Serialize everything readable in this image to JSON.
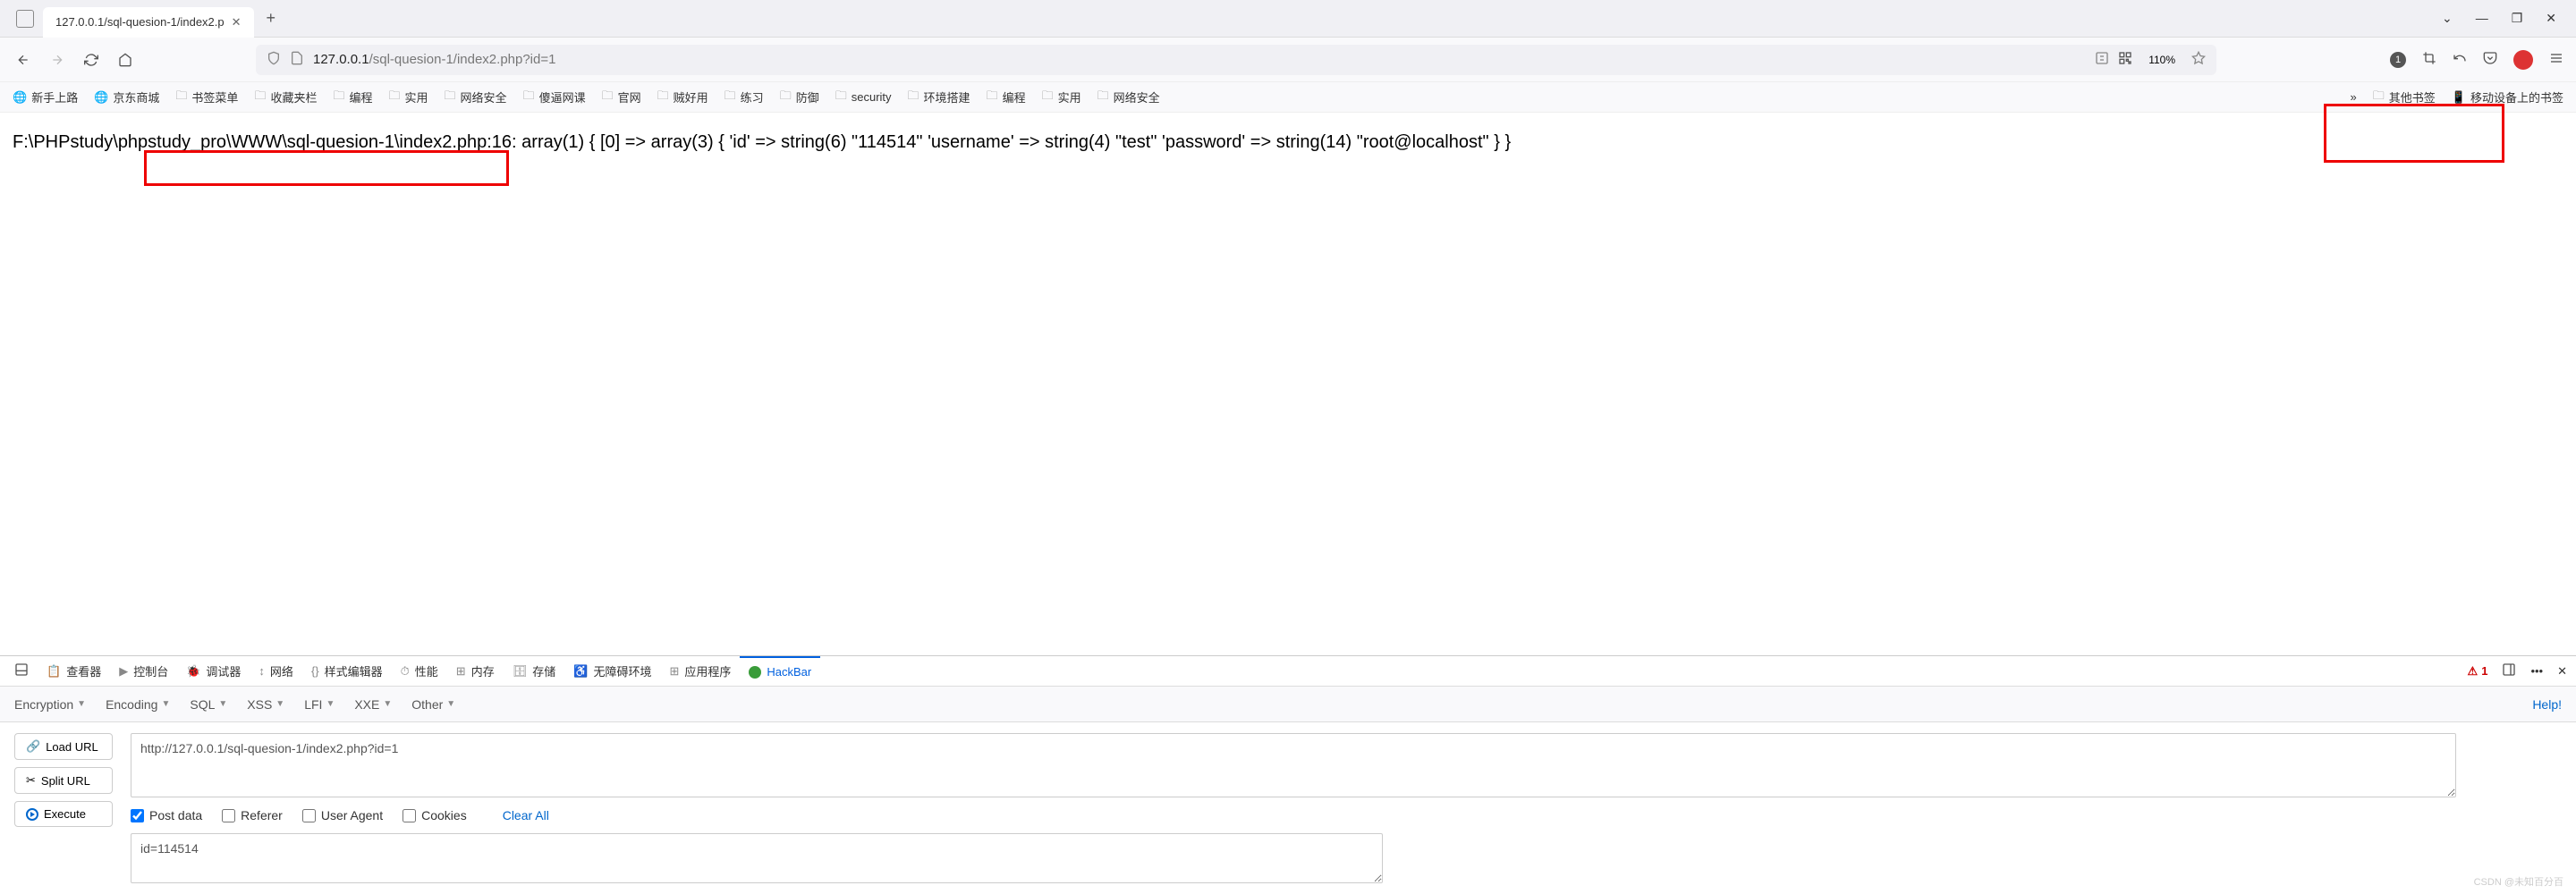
{
  "window": {
    "tab_title": "127.0.0.1/sql-quesion-1/index2.p",
    "new_tab": "+",
    "minimize": "—",
    "maximize": "❐",
    "close": "✕"
  },
  "nav": {
    "url_host": "127.0.0.1",
    "url_path": "/sql-quesion-1/index2.php?id=1",
    "zoom": "110%",
    "badge_count": "1"
  },
  "bookmarks": {
    "items": [
      {
        "icon": "globe",
        "label": "新手上路"
      },
      {
        "icon": "globe",
        "label": "京东商城"
      },
      {
        "icon": "folder",
        "label": "书签菜单"
      },
      {
        "icon": "folder",
        "label": "收藏夹栏"
      },
      {
        "icon": "folder",
        "label": "编程"
      },
      {
        "icon": "folder",
        "label": "实用"
      },
      {
        "icon": "folder",
        "label": "网络安全"
      },
      {
        "icon": "folder",
        "label": "傻逼网课"
      },
      {
        "icon": "folder",
        "label": "官网"
      },
      {
        "icon": "folder",
        "label": "贼好用"
      },
      {
        "icon": "folder",
        "label": "练习"
      },
      {
        "icon": "folder",
        "label": "防御"
      },
      {
        "icon": "folder",
        "label": "security"
      },
      {
        "icon": "folder",
        "label": "环境搭建"
      },
      {
        "icon": "folder",
        "label": "编程"
      },
      {
        "icon": "folder",
        "label": "实用"
      },
      {
        "icon": "folder",
        "label": "网络安全"
      }
    ],
    "overflow_chevron": "»",
    "other": "其他书签",
    "mobile": "移动设备上的书签"
  },
  "page": {
    "content": "F:\\PHPstudy\\phpstudy_pro\\WWW\\sql-quesion-1\\index2.php:16: array(1) { [0] => array(3) { 'id' => string(6) \"114514\" 'username' => string(4) \"test\" 'password' => string(14) \"root@localhost\" } }"
  },
  "devtools": {
    "tabs": [
      {
        "label": "查看器"
      },
      {
        "label": "控制台"
      },
      {
        "label": "调试器"
      },
      {
        "label": "网络"
      },
      {
        "label": "样式编辑器"
      },
      {
        "label": "性能"
      },
      {
        "label": "内存"
      },
      {
        "label": "存储"
      },
      {
        "label": "无障碍环境"
      },
      {
        "label": "应用程序"
      },
      {
        "label": "HackBar",
        "active": true
      }
    ],
    "error_count": "1"
  },
  "hackbar": {
    "menus": [
      "Encryption",
      "Encoding",
      "SQL",
      "XSS",
      "LFI",
      "XXE",
      "Other"
    ],
    "help": "Help!",
    "buttons": {
      "load": "Load URL",
      "split": "Split URL",
      "execute": "Execute"
    },
    "url": "http://127.0.0.1/sql-quesion-1/index2.php?id=1",
    "options": {
      "post": "Post data",
      "referer": "Referer",
      "ua": "User Agent",
      "cookies": "Cookies",
      "clear": "Clear All"
    },
    "post_data": "id=114514"
  },
  "watermark": "CSDN @未知百分百"
}
